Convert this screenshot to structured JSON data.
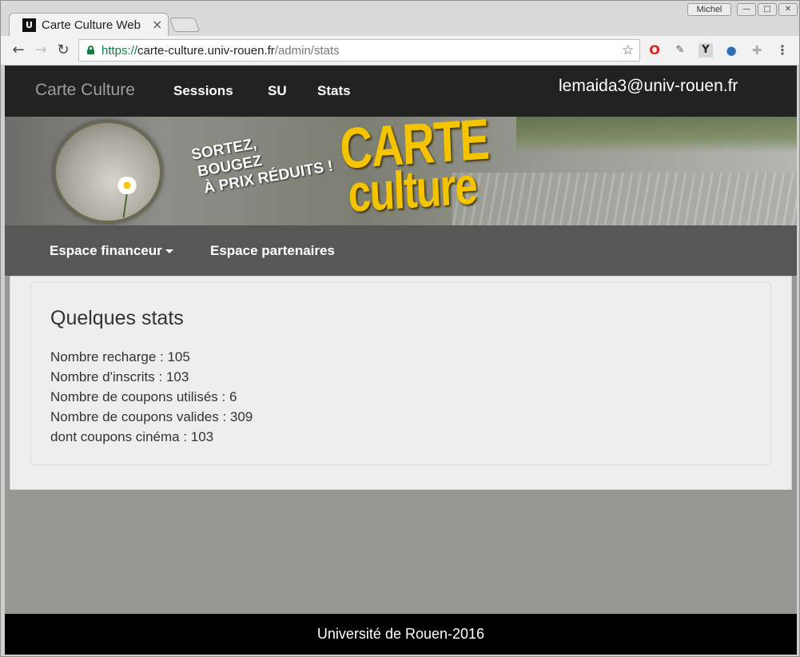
{
  "browser": {
    "tab_title": "Carte Culture Web",
    "tab_favicon": "ui-favicon",
    "profile_name": "Michel",
    "url": {
      "scheme": "https://",
      "host": "carte-culture.univ-rouen.fr",
      "path": "/admin/stats"
    }
  },
  "navbar": {
    "brand": "Carte Culture",
    "items": [
      {
        "label": "Sessions"
      },
      {
        "label": "SU"
      },
      {
        "label": "Stats"
      }
    ],
    "user_email": "lemaida3@univ-rouen.fr"
  },
  "banner": {
    "tagline": [
      "SORTEZ,",
      "BOUGEZ",
      "À PRIX RÉDUITS !"
    ],
    "title_line1": "CARTE",
    "title_line2": "culture"
  },
  "subnav": {
    "items": [
      {
        "label": "Espace financeur"
      },
      {
        "label": "Espace partenaires"
      }
    ]
  },
  "stats": {
    "title": "Quelques stats",
    "lines": [
      "Nombre recharge : 105",
      "Nombre d'inscrits : 103",
      "Nombre de coupons utilisés : 6",
      "Nombre de coupons valides : 309",
      "dont coupons cinéma : 103"
    ]
  },
  "footer": {
    "text": "Université de Rouen-2016"
  },
  "colors": {
    "navbar_bg": "#222222",
    "subnav_bg": "#575757",
    "brand_yellow": "#f5c400",
    "secure_green": "#0b8043",
    "footer_bg": "#000000"
  }
}
